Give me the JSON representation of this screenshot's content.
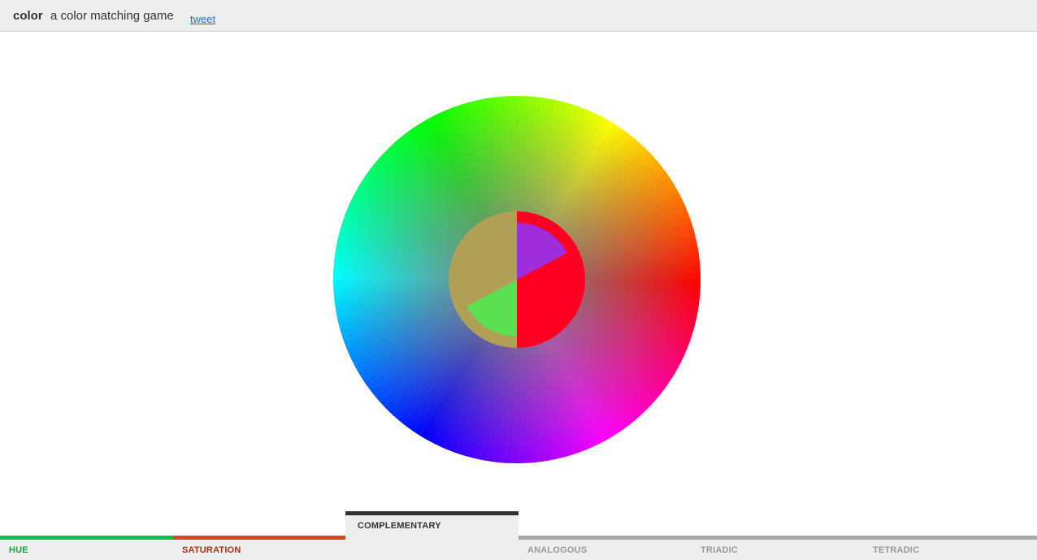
{
  "header": {
    "title": "color",
    "subtitle": "a color matching game",
    "tweet_label": "tweet",
    "link_color": "#1a6fc4"
  },
  "game": {
    "wheel": {
      "center_color": "#808080",
      "outer_hues": [
        "#ff0022",
        "#ff8a3a",
        "#f4f44a",
        "#00f050",
        "#00f0f0",
        "#0a22f0",
        "#8a22f0",
        "#ff22ff"
      ]
    },
    "target": {
      "left_color": "#b0a055",
      "right_color": "#ff0022"
    },
    "guesses": [
      {
        "name": "guess-purple",
        "color": "#a02ddc"
      },
      {
        "name": "guess-green",
        "color": "#5ae050"
      }
    ]
  },
  "tabs": [
    {
      "name": "tab-hue",
      "label": "HUE",
      "bar_color": "#11c140",
      "text_color": "#1aa038",
      "active": false
    },
    {
      "name": "tab-saturation",
      "label": "SATURATION",
      "bar_color": "#d94420",
      "text_color": "#b03010",
      "active": false
    },
    {
      "name": "tab-complementary",
      "label": "COMPLEMENTARY",
      "bar_color": "#333333",
      "text_color": "#333333",
      "active": true
    },
    {
      "name": "tab-analogous",
      "label": "ANALOGOUS",
      "bar_color": "#a8a8a8",
      "text_color": "#999999",
      "active": false
    },
    {
      "name": "tab-triadic",
      "label": "TRIADIC",
      "bar_color": "#a8a8a8",
      "text_color": "#999999",
      "active": false
    },
    {
      "name": "tab-tetradic",
      "label": "TETRADIC",
      "bar_color": "#a8a8a8",
      "text_color": "#999999",
      "active": false
    }
  ]
}
